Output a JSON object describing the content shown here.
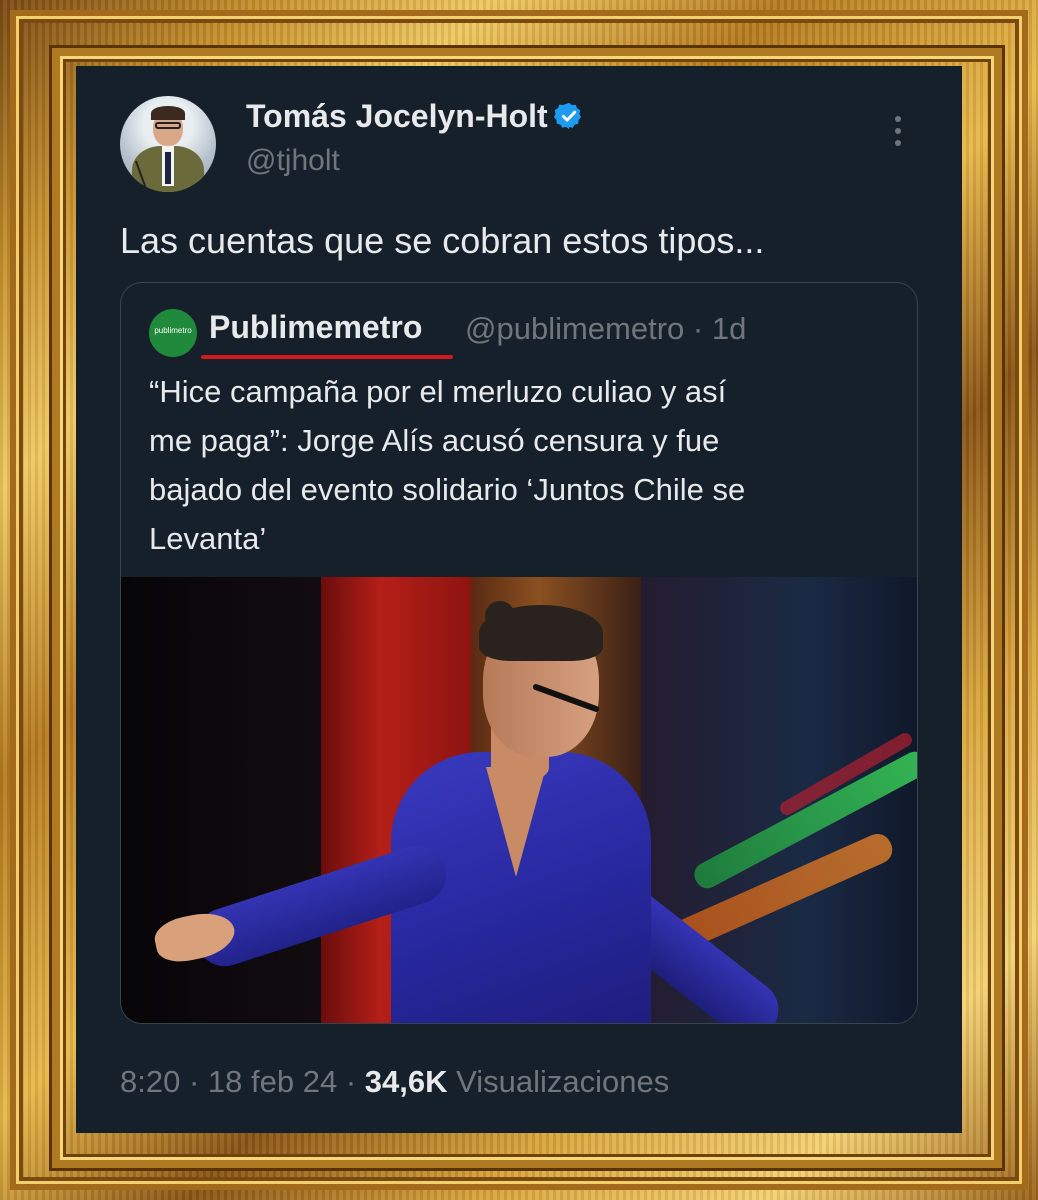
{
  "tweet": {
    "author_name": "Tomás Jocelyn-Holt",
    "author_handle": "@tjholt",
    "text": "Las cuentas que se cobran estos tipos...",
    "time": "8:20",
    "date": "18 feb 24",
    "views_count": "34,6K",
    "views_label": "Visualizaciones",
    "separator": "·"
  },
  "quote": {
    "avatar_text": "publimetro",
    "name": "Publimemetro",
    "handle": "@publimemetro",
    "age": "1d",
    "text_lines": [
      "“Hice campaña por el merluzo culiao y así",
      "me paga”: Jorge Alís acusó censura y fue",
      "bajado del evento solidario ‘Juntos Chile se",
      "Levanta’"
    ]
  },
  "colors": {
    "background": "#15202b",
    "text_primary": "#e7e9ea",
    "text_secondary": "#71767b",
    "verified": "#1d9bf0",
    "underline": "#d11a1a",
    "frame_gold": "#c8922c"
  },
  "icons": {
    "verified": "verified-badge-icon",
    "more": "more-options-icon"
  }
}
